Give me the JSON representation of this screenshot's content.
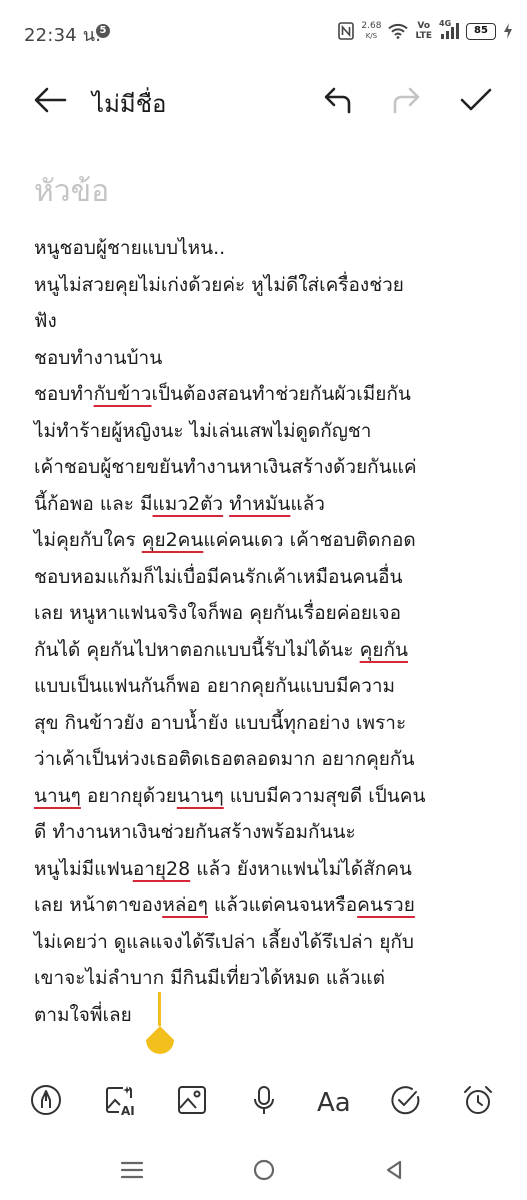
{
  "status_bar": {
    "time": "22:34 น.",
    "notification_count": "5",
    "net_speed_value": "2.68",
    "net_speed_unit": "K/S",
    "volte_top": "Vo",
    "volte_bottom": "LTE",
    "network_type": "4G",
    "battery": "85",
    "battery_fraction": 0.85,
    "battery_color": "#5dd35d"
  },
  "app_bar": {
    "title": "ไม่มีชื่อ"
  },
  "editor": {
    "heading_placeholder": "หัวข้อ",
    "lines": [
      [
        {
          "t": "หนูชอบผู้ชายแบบไหน.."
        }
      ],
      [
        {
          "t": "หนูไม่สวยคุยไม่เก่งด้วยค่ะ หูไม่ดีใส่เครื่องช่วย"
        }
      ],
      [
        {
          "t": "ฟัง"
        }
      ],
      [
        {
          "t": "ชอบทำงานบ้าน"
        }
      ],
      [
        {
          "t": "ชอบทำ"
        },
        {
          "t": "กับข้าว",
          "u": true
        },
        {
          "t": "เป็นต้องสอนทำช่วยกันผัวเมียกัน"
        }
      ],
      [
        {
          "t": "ไม่ทำร้ายผู้หญิงนะ ไม่เล่นเสพไม่ดูดกัญชา"
        }
      ],
      [
        {
          "t": "เค้าชอบผู้ชายขยันทำงานหาเงินสร้างด้วยกันแค่"
        }
      ],
      [
        {
          "t": "นี้ก้อพอ และ มี"
        },
        {
          "t": "แมว2ตัว",
          "u": true
        },
        {
          "t": " "
        },
        {
          "t": "ทำหมัน",
          "u": true
        },
        {
          "t": "แล้ว"
        }
      ],
      [
        {
          "t": "ไม่คุยกับใคร "
        },
        {
          "t": "คุย2คน",
          "u": true
        },
        {
          "t": "แค่คนเดว เค้าชอบติดกอด"
        }
      ],
      [
        {
          "t": "ชอบหอมแก้มก็ไม่เบื่อมีคนรักเค้าเหมือนคนอื่น"
        }
      ],
      [
        {
          "t": "เลย หนูหาแฟนจริงใจก็พอ คุยกันเรื่อยค่อยเจอ"
        }
      ],
      [
        {
          "t": "กันได้ คุยกันไปหาตอกแบบนี้รับไม่ได้นะ "
        },
        {
          "t": "คุยกัน",
          "u": true
        }
      ],
      [
        {
          "t": "แบบเป็นแฟนกันก็พอ  อยากคุยกันแบบมีความ"
        }
      ],
      [
        {
          "t": "สุข กินข้าวยัง  อาบน้ำยัง แบบนี้ทุกอย่าง เพราะ"
        }
      ],
      [
        {
          "t": "ว่าเค้าเป็นห่วงเธอติดเธอตลอดมาก อยากคุยกัน"
        }
      ],
      [
        {
          "t": "นานๆ",
          "u": true
        },
        {
          "t": " อยากยุด้วย"
        },
        {
          "t": "นานๆ",
          "u": true
        },
        {
          "t": " แบบมีความสุขดี เป็นคน"
        }
      ],
      [
        {
          "t": "ดี ทำงานหาเงินช่วยกันสร้างพร้อมกันนะ"
        }
      ],
      [
        {
          "t": "หนูไม่มีแฟน"
        },
        {
          "t": "อายุ28",
          "u": true
        },
        {
          "t": "  แล้ว ยังหาแฟนไม่ได้สักคน"
        }
      ],
      [
        {
          "t": "เลย หน้าตาของ"
        },
        {
          "t": "หล่อๆ",
          "u": true
        },
        {
          "t": " แล้วแต่คนจนหรือ"
        },
        {
          "t": "คนรวย",
          "u": true
        }
      ],
      [
        {
          "t": "ไม่เคยว่า ดูแลแจงได้รึเปล่า เลี้ยงได้รึเปล่า ยุกับ"
        }
      ],
      [
        {
          "t": "เขาจะไม่ลำบาก มีกินมีเที่ยวได้หมด แล้วแต่"
        }
      ],
      [
        {
          "t": "ตามใจพี่เลย"
        }
      ]
    ],
    "spellcheck_color": "#d6263a",
    "cursor_color": "#f2bf1c"
  }
}
